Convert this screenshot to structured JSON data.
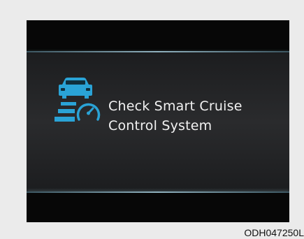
{
  "display": {
    "message_line1": "Check Smart Cruise",
    "message_line2": "Control System",
    "icon": "smart-cruise-control-icon",
    "icon_color": "#2aa3d6",
    "text_color": "#f2f2f2"
  },
  "figure_code": "ODH047250L"
}
